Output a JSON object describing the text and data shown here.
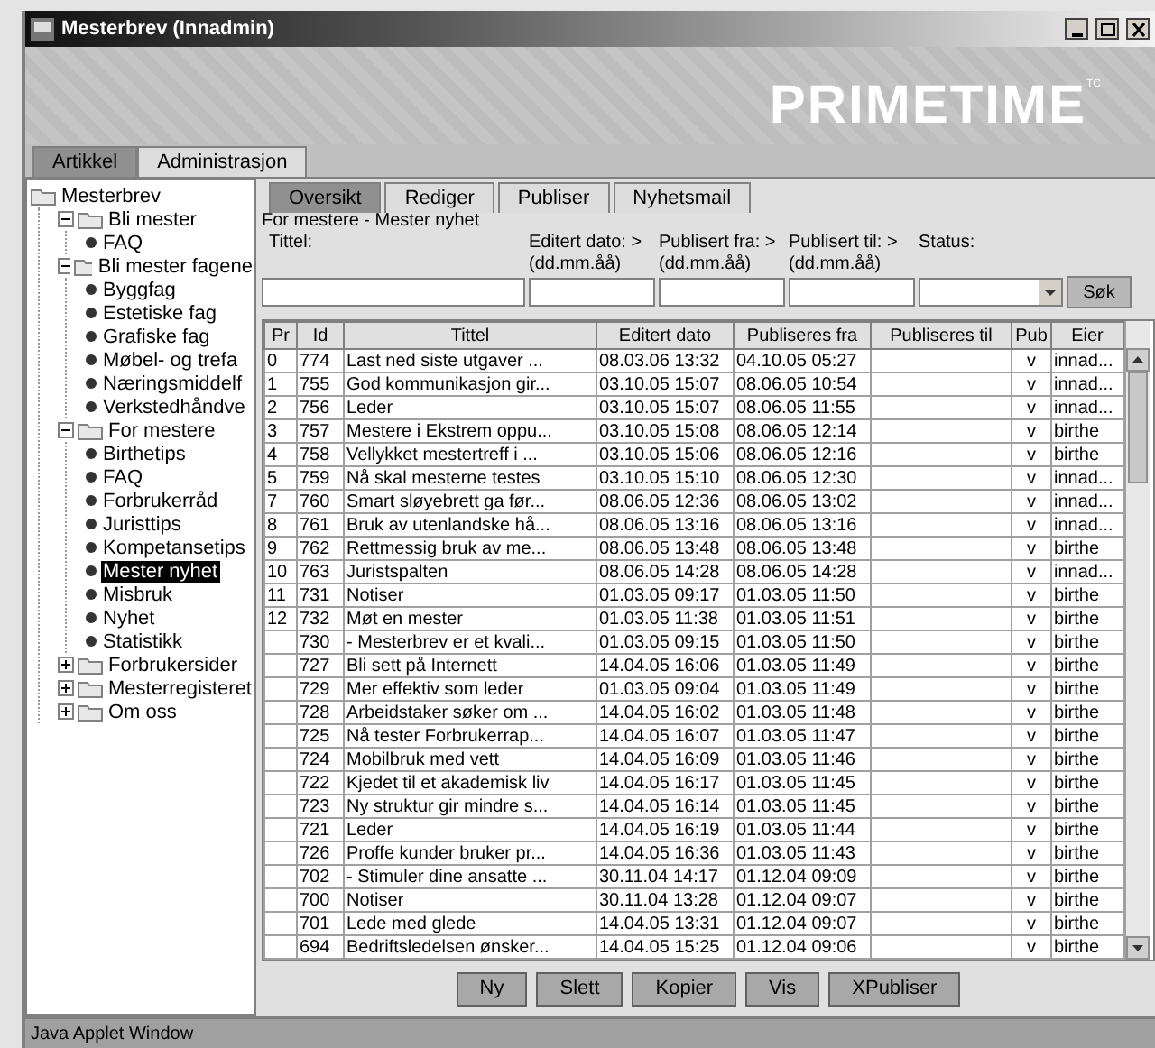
{
  "window": {
    "title": "Mesterbrev (Innadmin)"
  },
  "logo": {
    "text": "PRIMETIME",
    "mark": "TC"
  },
  "tabs": [
    {
      "label": "Artikkel",
      "selected": true
    },
    {
      "label": "Administrasjon",
      "selected": false
    }
  ],
  "tree": [
    {
      "label": "Mesterbrev",
      "kind": "folder",
      "selected": false,
      "children": [
        {
          "label": "Bli mester",
          "kind": "folder",
          "expanded": true,
          "selected": false,
          "children": [
            {
              "label": "FAQ",
              "kind": "leaf",
              "selected": false
            }
          ]
        },
        {
          "label": "Bli mester fagene",
          "kind": "folder",
          "expanded": true,
          "selected": false,
          "children": [
            {
              "label": "Byggfag",
              "kind": "leaf",
              "selected": false
            },
            {
              "label": "Estetiske fag",
              "kind": "leaf",
              "selected": false
            },
            {
              "label": "Grafiske fag",
              "kind": "leaf",
              "selected": false
            },
            {
              "label": "Møbel- og trefa",
              "kind": "leaf",
              "selected": false
            },
            {
              "label": "Næringsmiddelf",
              "kind": "leaf",
              "selected": false
            },
            {
              "label": "Verkstedhåndve",
              "kind": "leaf",
              "selected": false
            }
          ]
        },
        {
          "label": "For mestere",
          "kind": "folder",
          "expanded": true,
          "selected": false,
          "children": [
            {
              "label": "Birthetips",
              "kind": "leaf",
              "selected": false
            },
            {
              "label": "FAQ",
              "kind": "leaf",
              "selected": false
            },
            {
              "label": "Forbrukerråd",
              "kind": "leaf",
              "selected": false
            },
            {
              "label": "Juristtips",
              "kind": "leaf",
              "selected": false
            },
            {
              "label": "Kompetansetips",
              "kind": "leaf",
              "selected": false
            },
            {
              "label": "Mester nyhet",
              "kind": "leaf",
              "selected": true
            },
            {
              "label": "Misbruk",
              "kind": "leaf",
              "selected": false
            },
            {
              "label": "Nyhet",
              "kind": "leaf",
              "selected": false
            },
            {
              "label": "Statistikk",
              "kind": "leaf",
              "selected": false
            }
          ]
        },
        {
          "label": "Forbrukersider",
          "kind": "folder",
          "expanded": false,
          "selected": false
        },
        {
          "label": "Mesterregisteret",
          "kind": "folder",
          "expanded": false,
          "selected": false
        },
        {
          "label": "Om oss",
          "kind": "folder",
          "expanded": false,
          "selected": false
        }
      ]
    }
  ],
  "subtabs": [
    {
      "label": "Oversikt",
      "selected": true
    },
    {
      "label": "Rediger",
      "selected": false
    },
    {
      "label": "Publiser",
      "selected": false
    },
    {
      "label": "Nyhetsmail",
      "selected": false
    }
  ],
  "breadcrumb": "For mestere - Mester nyhet",
  "search": {
    "labels": [
      "Tittel:",
      "Editert dato: >",
      "Publisert fra: >",
      "Publisert til: >",
      "Status:"
    ],
    "formats": [
      "(dd.mm.åå)",
      "(dd.mm.åå)",
      "(dd.mm.åå)"
    ],
    "button": "Søk"
  },
  "table": {
    "columns": [
      "Pr",
      "Id",
      "Tittel",
      "Editert dato",
      "Publiseres fra",
      "Publiseres til",
      "Pub",
      "Eier"
    ],
    "rows": [
      {
        "pr": "0",
        "id": "774",
        "title": "Last ned siste utgaver ...",
        "edited": "08.03.06 13:32",
        "from": "04.10.05 05:27",
        "pub": "v",
        "owner": "innad..."
      },
      {
        "pr": "1",
        "id": "755",
        "title": "God kommunikasjon gir...",
        "edited": "03.10.05 15:07",
        "from": "08.06.05 10:54",
        "pub": "v",
        "owner": "innad..."
      },
      {
        "pr": "2",
        "id": "756",
        "title": "Leder",
        "edited": "03.10.05 15:07",
        "from": "08.06.05 11:55",
        "pub": "v",
        "owner": "innad..."
      },
      {
        "pr": "3",
        "id": "757",
        "title": "Mestere i Ekstrem oppu...",
        "edited": "03.10.05 15:08",
        "from": "08.06.05 12:14",
        "pub": "v",
        "owner": "birthe"
      },
      {
        "pr": "4",
        "id": "758",
        "title": "Vellykket mestertreff i ...",
        "edited": "03.10.05 15:06",
        "from": "08.06.05 12:16",
        "pub": "v",
        "owner": "birthe"
      },
      {
        "pr": "5",
        "id": "759",
        "title": "Nå skal mesterne testes",
        "edited": "03.10.05 15:10",
        "from": "08.06.05 12:30",
        "pub": "v",
        "owner": "innad..."
      },
      {
        "pr": "7",
        "id": "760",
        "title": "Smart sløyebrett ga før...",
        "edited": "08.06.05 12:36",
        "from": "08.06.05 13:02",
        "pub": "v",
        "owner": "innad..."
      },
      {
        "pr": "8",
        "id": "761",
        "title": "Bruk av utenlandske hå...",
        "edited": "08.06.05 13:16",
        "from": "08.06.05 13:16",
        "pub": "v",
        "owner": "innad..."
      },
      {
        "pr": "9",
        "id": "762",
        "title": "Rettmessig bruk av me...",
        "edited": "08.06.05 13:48",
        "from": "08.06.05 13:48",
        "pub": "v",
        "owner": "birthe"
      },
      {
        "pr": "10",
        "id": "763",
        "title": "Juristspalten",
        "edited": "08.06.05 14:28",
        "from": "08.06.05 14:28",
        "pub": "v",
        "owner": "innad..."
      },
      {
        "pr": "11",
        "id": "731",
        "title": "Notiser",
        "edited": "01.03.05 09:17",
        "from": "01.03.05 11:50",
        "pub": "v",
        "owner": "birthe"
      },
      {
        "pr": "12",
        "id": "732",
        "title": "Møt en mester",
        "edited": "01.03.05 11:38",
        "from": "01.03.05 11:51",
        "pub": "v",
        "owner": "birthe"
      },
      {
        "id": "730",
        "title": "- Mesterbrev er et kvali...",
        "edited": "01.03.05 09:15",
        "from": "01.03.05 11:50",
        "pub": "v",
        "owner": "birthe"
      },
      {
        "id": "727",
        "title": "Bli sett på Internett",
        "edited": "14.04.05 16:06",
        "from": "01.03.05 11:49",
        "pub": "v",
        "owner": "birthe"
      },
      {
        "id": "729",
        "title": "Mer effektiv som leder",
        "edited": "01.03.05 09:04",
        "from": "01.03.05 11:49",
        "pub": "v",
        "owner": "birthe"
      },
      {
        "id": "728",
        "title": "Arbeidstaker søker om ...",
        "edited": "14.04.05 16:02",
        "from": "01.03.05 11:48",
        "pub": "v",
        "owner": "birthe"
      },
      {
        "id": "725",
        "title": "Nå tester Forbrukerrap...",
        "edited": "14.04.05 16:07",
        "from": "01.03.05 11:47",
        "pub": "v",
        "owner": "birthe"
      },
      {
        "id": "724",
        "title": "Mobilbruk med vett",
        "edited": "14.04.05 16:09",
        "from": "01.03.05 11:46",
        "pub": "v",
        "owner": "birthe"
      },
      {
        "id": "722",
        "title": "Kjedet til et akademisk liv",
        "edited": "14.04.05 16:17",
        "from": "01.03.05 11:45",
        "pub": "v",
        "owner": "birthe"
      },
      {
        "id": "723",
        "title": "Ny struktur gir mindre s...",
        "edited": "14.04.05 16:14",
        "from": "01.03.05 11:45",
        "pub": "v",
        "owner": "birthe"
      },
      {
        "id": "721",
        "title": "Leder",
        "edited": "14.04.05 16:19",
        "from": "01.03.05 11:44",
        "pub": "v",
        "owner": "birthe"
      },
      {
        "id": "726",
        "title": "Proffe kunder bruker pr...",
        "edited": "14.04.05 16:36",
        "from": "01.03.05 11:43",
        "pub": "v",
        "owner": "birthe"
      },
      {
        "id": "702",
        "title": "- Stimuler dine ansatte ...",
        "edited": "30.11.04 14:17",
        "from": "01.12.04 09:09",
        "pub": "v",
        "owner": "birthe"
      },
      {
        "id": "700",
        "title": "Notiser",
        "edited": "30.11.04 13:28",
        "from": "01.12.04 09:07",
        "pub": "v",
        "owner": "birthe"
      },
      {
        "id": "701",
        "title": "Lede med glede",
        "edited": "14.04.05 13:31",
        "from": "01.12.04 09:07",
        "pub": "v",
        "owner": "birthe"
      },
      {
        "id": "694",
        "title": "Bedriftsledelsen ønsker...",
        "edited": "14.04.05 15:25",
        "from": "01.12.04 09:06",
        "pub": "v",
        "owner": "birthe"
      }
    ]
  },
  "buttons": [
    "Ny",
    "Slett",
    "Kopier",
    "Vis",
    "XPubliser"
  ],
  "status_bar": "Java Applet Window"
}
